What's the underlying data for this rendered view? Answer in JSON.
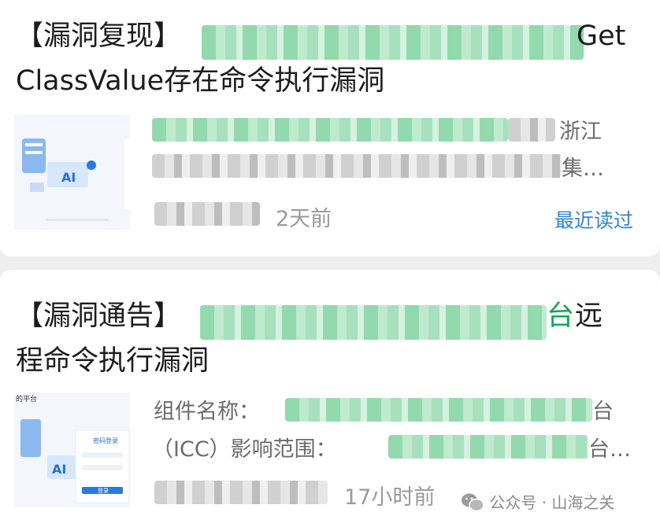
{
  "articles": [
    {
      "title_prefix": "【漏洞复现】",
      "title_green_char": "",
      "title_end_line1": "Get",
      "title_line2": "ClassValue存在命令执行漏洞",
      "snippet_line1_end": "浙江",
      "snippet_line2_end": "集…",
      "time": "2天前",
      "recent_label": "最近读过"
    },
    {
      "title_prefix": "【漏洞通告】",
      "title_green_char": "台",
      "title_end_line1": "远",
      "title_line2": "程命令执行漏洞",
      "snippet_line1": "组件名称：",
      "snippet_line1_green_end": "台",
      "snippet_line2": "（ICC）影响范围：",
      "snippet_line2_green_end": "台…",
      "time": "17小时前",
      "thumb_header": "的平台",
      "thumb_login_title": "密码登录",
      "thumb_login_button": "登录"
    }
  ],
  "watermark": {
    "text": "公众号 · 山海之关",
    "icon": "wechat-icon"
  },
  "colors": {
    "green": "#16a35a",
    "link": "#2f86d6",
    "meta": "#9a9a9a"
  }
}
